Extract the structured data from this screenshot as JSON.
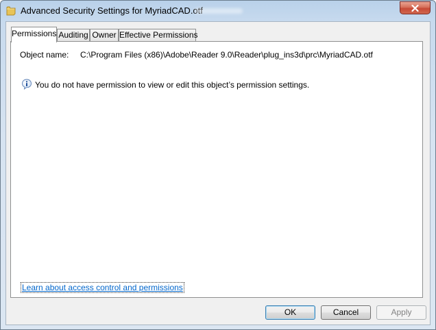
{
  "window": {
    "title": "Advanced Security Settings for MyriadCAD.otf"
  },
  "tabs": [
    {
      "label": "Permissions",
      "active": true
    },
    {
      "label": "Auditing",
      "active": false
    },
    {
      "label": "Owner",
      "active": false
    },
    {
      "label": "Effective Permissions",
      "active": false
    }
  ],
  "permissions": {
    "object_name_label": "Object name:",
    "object_name_value": "C:\\Program Files (x86)\\Adobe\\Reader 9.0\\Reader\\plug_ins3d\\prc\\MyriadCAD.otf",
    "info_message": "You do not have permission to view or edit this object’s permission settings.",
    "learn_link": "Learn about access control and permissions"
  },
  "buttons": {
    "ok": "OK",
    "cancel": "Cancel",
    "apply": "Apply"
  },
  "icons": {
    "title": "folder-icon",
    "close": "close-icon",
    "info": "info-icon"
  },
  "colors": {
    "link": "#0066cc",
    "close_button": "#c74a36",
    "title_gradient": "#b9d1ea"
  }
}
